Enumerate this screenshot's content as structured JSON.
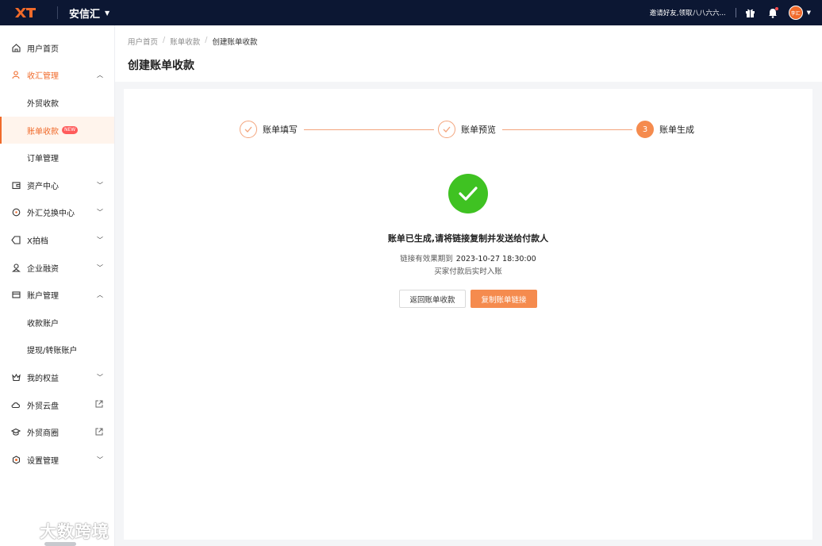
{
  "app": {
    "logo_text": "XT",
    "brand_name": "安信汇"
  },
  "topbar": {
    "invite_text": "邀请好友,领取八八六六...",
    "avatar_text": "李汇"
  },
  "sidebar": {
    "items": [
      {
        "label": "用户首页",
        "icon": "home-icon"
      },
      {
        "label": "收汇管理",
        "icon": "user-icon",
        "expanded": true
      },
      {
        "label": "外贸收款"
      },
      {
        "label": "账单收款",
        "badge": "NEW",
        "active": true
      },
      {
        "label": "订单管理"
      },
      {
        "label": "资产中心",
        "icon": "wallet-icon"
      },
      {
        "label": "外汇兑换中心",
        "icon": "exchange-icon"
      },
      {
        "label": "X拍档",
        "icon": "tag-icon"
      },
      {
        "label": "企业融资",
        "icon": "finance-icon"
      },
      {
        "label": "账户管理",
        "icon": "card-icon",
        "expanded": true
      },
      {
        "label": "收款账户"
      },
      {
        "label": "提现/转账账户"
      },
      {
        "label": "我的权益",
        "icon": "crown-icon"
      },
      {
        "label": "外贸云盘",
        "icon": "cloud-icon"
      },
      {
        "label": "外贸商圈",
        "icon": "graduation-icon"
      },
      {
        "label": "设置管理",
        "icon": "settings-icon"
      }
    ]
  },
  "watermark": "大数跨境",
  "breadcrumb": [
    "用户首页",
    "账单收款",
    "创建账单收款"
  ],
  "page_title": "创建账单收款",
  "steps": [
    {
      "label": "账单填写",
      "status": "done"
    },
    {
      "label": "账单预览",
      "status": "done"
    },
    {
      "label": "账单生成",
      "status": "current",
      "number": "3"
    }
  ],
  "result": {
    "title": "账单已生成,请将链接复制并发送给付款人",
    "expiry_label": "链接有效果期到",
    "expiry_date": "2023-10-27 18:30:00",
    "note": "买家付款后实时入账"
  },
  "buttons": {
    "back": "返回账单收款",
    "copy": "复制账单链接"
  },
  "colors": {
    "topbar": "#0c1733",
    "accent": "#f58b4e",
    "success": "#3fc222"
  }
}
